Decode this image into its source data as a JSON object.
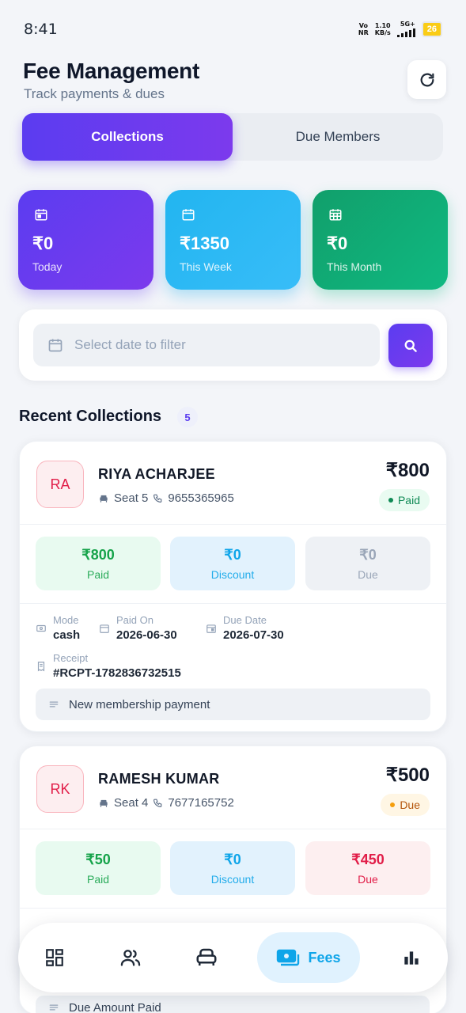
{
  "status_bar": {
    "time": "8:41",
    "net_line1": "Vo",
    "net_line2": "NR",
    "speed_line1": "1.10",
    "speed_line2": "KB/s",
    "network": "5G+",
    "battery": "26"
  },
  "header": {
    "title": "Fee Management",
    "subtitle": "Track payments & dues",
    "refresh_icon": "refresh-icon"
  },
  "tabs": [
    {
      "label": "Collections",
      "active": true
    },
    {
      "label": "Due Members",
      "active": false
    }
  ],
  "stats": [
    {
      "value": "₹0",
      "label": "Today",
      "icon": "calendar-icon",
      "color": "#5b3cf0"
    },
    {
      "value": "₹1350",
      "label": "This Week",
      "icon": "calendar-icon",
      "color": "#22b5f0"
    },
    {
      "value": "₹0",
      "label": "This Month",
      "icon": "calendar-grid-icon",
      "color": "#119f6b"
    }
  ],
  "filter": {
    "placeholder": "Select date to filter",
    "search_icon": "search-icon"
  },
  "recent": {
    "title": "Recent Collections",
    "count": "5"
  },
  "collections": [
    {
      "initials": "RA",
      "name": "RIYA ACHARJEE",
      "seat": "Seat 5",
      "phone": "9655365965",
      "amount": "₹800",
      "status": "Paid",
      "paid_value": "₹800",
      "paid_label": "Paid",
      "discount_value": "₹0",
      "discount_label": "Discount",
      "due_value": "₹0",
      "due_label": "Due",
      "mode_label": "Mode",
      "mode_value": "cash",
      "paid_on_label": "Paid On",
      "paid_on_value": "2026-06-30",
      "due_date_label": "Due Date",
      "due_date_value": "2026-07-30",
      "receipt_label": "Receipt",
      "receipt_value": "#RCPT-1782836732515",
      "note": "New membership payment"
    },
    {
      "initials": "RK",
      "name": "RAMESH KUMAR",
      "seat": "Seat 4",
      "phone": "7677165752",
      "amount": "₹500",
      "status": "Due",
      "paid_value": "₹50",
      "paid_label": "Paid",
      "discount_value": "₹0",
      "discount_label": "Discount",
      "due_value": "₹450",
      "due_label": "Due",
      "note": "Due Amount Paid"
    }
  ],
  "bottom_nav": [
    {
      "icon": "dashboard-icon"
    },
    {
      "icon": "members-icon"
    },
    {
      "icon": "seat-icon"
    },
    {
      "icon": "fees-icon",
      "label": "Fees",
      "active": true
    },
    {
      "icon": "reports-icon"
    }
  ],
  "colors": {
    "accent": "#5b3cf0",
    "paid": "#16a34a",
    "discount": "#0ea5e9",
    "due": "#e11d48",
    "warn": "#f59e0b"
  }
}
